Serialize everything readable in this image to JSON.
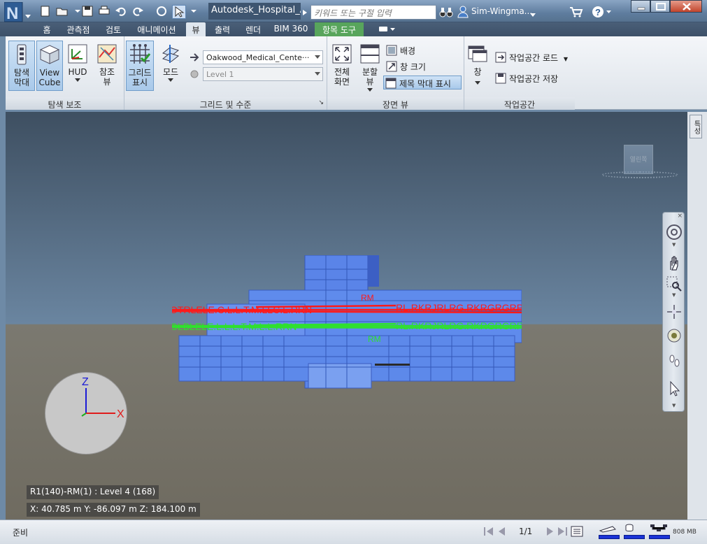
{
  "title_bar": {
    "document_title": "Autodesk_Hospital_Ar...",
    "search_placeholder": "키워드 또는 구절 입력",
    "user_name": "Sim-Wingma...",
    "icons": [
      "app-logo-icon",
      "new-icon",
      "open-icon",
      "save-icon",
      "print-icon",
      "undo-icon",
      "redo-icon",
      "refresh-icon",
      "select-icon",
      "binoculars-icon",
      "user-icon",
      "cart-icon",
      "help-icon"
    ]
  },
  "tabs": [
    {
      "label": "홈",
      "active": false
    },
    {
      "label": "관측점",
      "active": false
    },
    {
      "label": "검토",
      "active": false
    },
    {
      "label": "애니메이션",
      "active": false
    },
    {
      "label": "뷰",
      "active": true
    },
    {
      "label": "출력",
      "active": false
    },
    {
      "label": "렌더",
      "active": false
    },
    {
      "label": "BIM 360",
      "active": false
    },
    {
      "label": "항목 도구",
      "active": false,
      "contextual": true
    }
  ],
  "ribbon": {
    "nav_aids": {
      "title": "탐색 보조",
      "nav_bar_label": "탐색\n막대",
      "viewcube_label": "View\nCube",
      "hud_label": "HUD",
      "reference_views_label": "참조\n뷰"
    },
    "grids_levels": {
      "title": "그리드 및 수준",
      "show_grid_label": "그리드\n표시",
      "mode_label": "모드",
      "model_combo": "Oakwood_Medical_Cente···",
      "level_combo": "Level 1"
    },
    "scene_view": {
      "title": "장면 뷰",
      "full_screen_label": "전체\n화면",
      "split_view_label": "분할\n뷰",
      "background_label": "배경",
      "window_size_label": "창 크기",
      "show_title_bar_label": "제목 막대 표시"
    },
    "workspace": {
      "title": "작업공간",
      "windows_label": "창",
      "load_workspace_label": "작업공간 로드",
      "save_workspace_label": "작업공간 저장"
    }
  },
  "viewport": {
    "viewcube_face": "열린쪽",
    "axis_labels": {
      "z": "Z",
      "x": "X"
    },
    "selection_readout": "R1(140)-RM(1) : Level 4 (168)",
    "coords_readout": "X: 40.785 m  Y: -86.097 m  Z: 184.100 m",
    "right_tab": "특성",
    "nav_bar_icons": [
      "steeringwheel-icon",
      "pan-icon",
      "zoom-window-icon",
      "orbit-icon",
      "look-icon",
      "walk-icon",
      "select-arrow-icon"
    ]
  },
  "status_bar": {
    "status": "준비",
    "page": "1/1",
    "memory": "808 MB"
  },
  "colors": {
    "accent": "#5b8fd6",
    "contextual_tab": "#58a55c",
    "grid_red": "#ff1a1a",
    "grid_green": "#2fe02f"
  }
}
